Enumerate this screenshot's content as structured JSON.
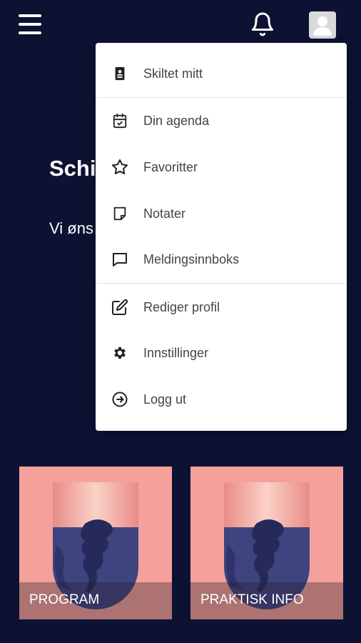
{
  "header": {
    "menu_icon": "hamburger-menu-icon",
    "notification_icon": "bell-icon",
    "avatar_icon": "user-avatar-icon"
  },
  "hero": {
    "title": "Schi",
    "text": "Vi øns"
  },
  "dropdown": {
    "items": [
      {
        "label": "Skiltet mitt",
        "icon": "badge-icon"
      },
      {
        "label": "Din agenda",
        "icon": "calendar-check-icon"
      },
      {
        "label": "Favoritter",
        "icon": "star-icon"
      },
      {
        "label": "Notater",
        "icon": "note-icon"
      },
      {
        "label": "Meldingsinnboks",
        "icon": "message-icon"
      },
      {
        "label": "Rediger profil",
        "icon": "edit-icon"
      },
      {
        "label": "Innstillinger",
        "icon": "gear-icon"
      },
      {
        "label": "Logg ut",
        "icon": "logout-icon"
      }
    ]
  },
  "cards": [
    {
      "label": "PROGRAM"
    },
    {
      "label": "PRAKTISK INFO"
    }
  ],
  "colors": {
    "background": "#0d1233",
    "card": "#f4a19b",
    "menu_bg": "#ffffff"
  }
}
